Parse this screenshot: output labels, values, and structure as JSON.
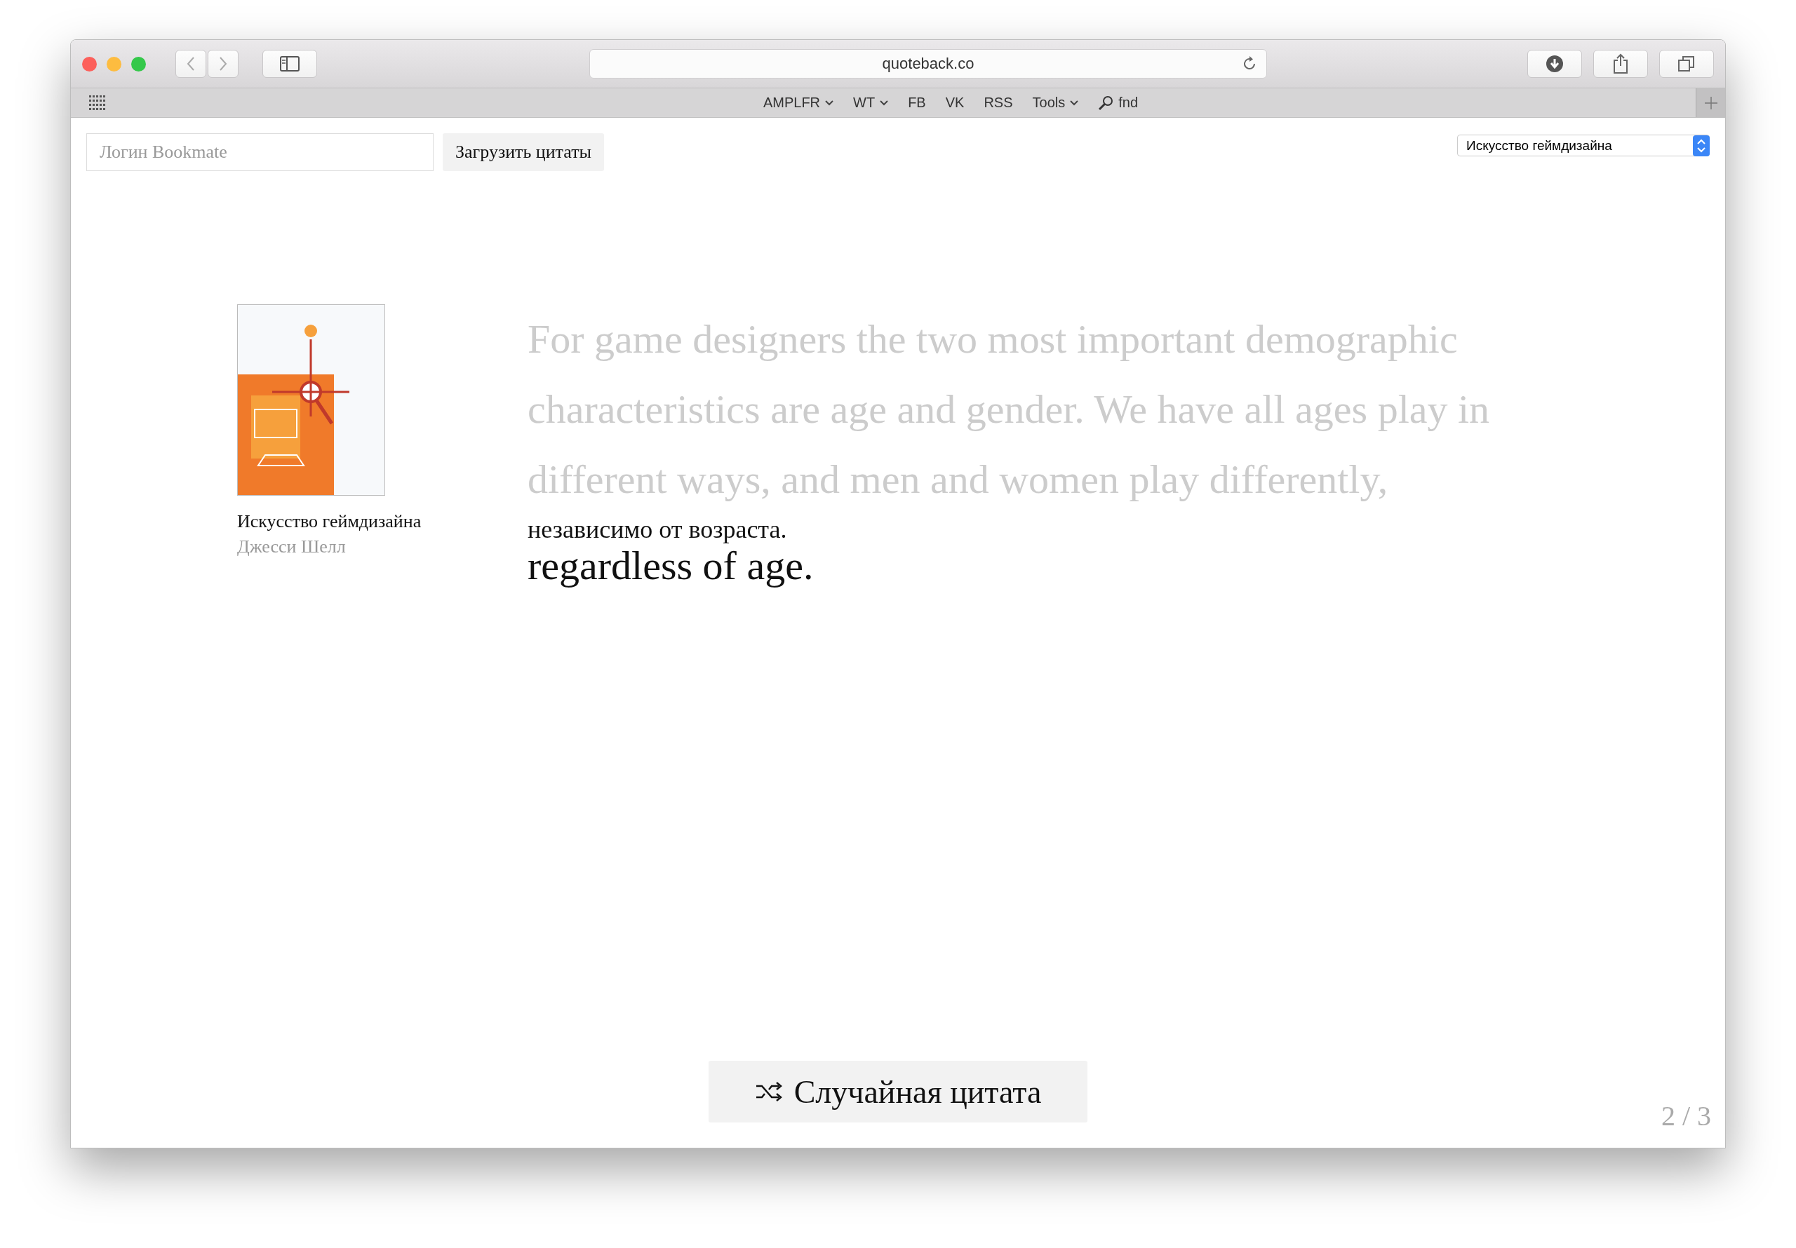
{
  "browser": {
    "address": "quoteback.co",
    "bookmarks": [
      {
        "label": "AMPLFR",
        "has_menu": true,
        "kind": "link"
      },
      {
        "label": "WT",
        "has_menu": true,
        "kind": "link"
      },
      {
        "label": "FB",
        "has_menu": false,
        "kind": "link"
      },
      {
        "label": "VK",
        "has_menu": false,
        "kind": "link"
      },
      {
        "label": "RSS",
        "has_menu": false,
        "kind": "link"
      },
      {
        "label": "Tools",
        "has_menu": true,
        "kind": "link"
      },
      {
        "label": "fnd",
        "has_menu": false,
        "kind": "search"
      }
    ]
  },
  "login": {
    "placeholder": "Логин Bookmate",
    "button": "Загрузить цитаты"
  },
  "book_select": {
    "value": "Искусство геймдизайна"
  },
  "book": {
    "title": "Искусство геймдизайна",
    "author": "Джесси Шелл"
  },
  "quote": {
    "faded_text": "For game designers the two most important demographic characteristics are age and gender. We have all ages play in different ways, and men and women play differently,",
    "translation": "независимо от возраста.",
    "highlighted_text": "regardless of age."
  },
  "random_button": {
    "label": "Случайная цитата"
  },
  "page_counter": "2 / 3"
}
